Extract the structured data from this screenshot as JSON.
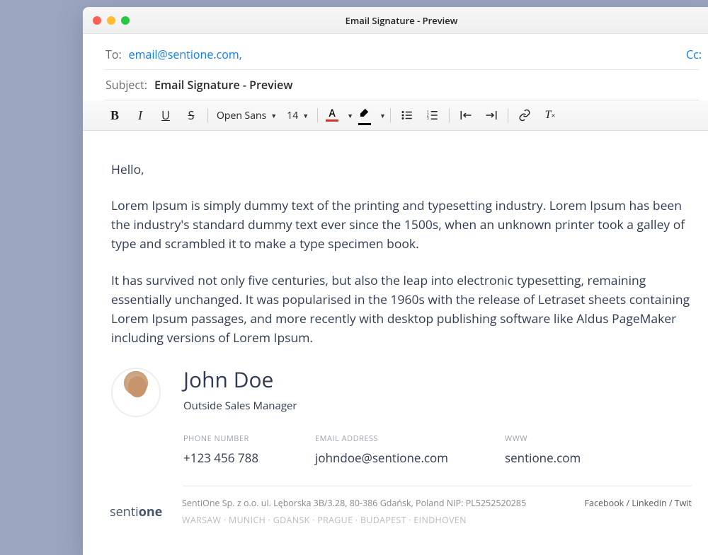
{
  "window": {
    "title": "Email Signature - Preview"
  },
  "compose": {
    "to_label": "To:",
    "to_value": "email@sentione.com,",
    "cc_label": "Cc:",
    "subject_label": "Subject:",
    "subject_value": "Email Signature - Preview"
  },
  "toolbar": {
    "font_name": "Open Sans",
    "font_size": "14"
  },
  "body": {
    "greeting": "Hello,",
    "p1": "Lorem Ipsum is simply dummy text of the printing and typesetting industry. Lorem Ipsum has been the industry's standard dummy text ever since the 1500s, when an unknown printer took a galley of type and scrambled it to make a type specimen book.",
    "p2": "It has survived not only five centuries, but also the leap into electronic typesetting, remaining essentially unchanged. It was popularised in the 1960s with the release of Letraset sheets containing Lorem Ipsum passages, and more recently with desktop publishing software like Aldus PageMaker including versions of Lorem Ipsum."
  },
  "signature": {
    "name": "John Doe",
    "title": "Outside Sales Manager",
    "phone_label": "PHONE NUMBER",
    "phone_value": "+123 456 788",
    "email_label": "EMAIL ADDRESS",
    "email_value": "johndoe@sentione.com",
    "www_label": "WWW",
    "www_value": "sentione.com"
  },
  "footer": {
    "logo_text_a": "senti",
    "logo_text_b": "one",
    "company": "SentiOne Sp. z o.o. ul. Lęborska 3B/3.28, 80-386 Gdańsk, Poland NIP: PL5252520285",
    "cities": "WARSAW · MUNICH · GDANSK · PRAGUE · BUDAPEST · EINDHOVEN",
    "social": "Facebook  /  Linkedin  /  Twit"
  }
}
